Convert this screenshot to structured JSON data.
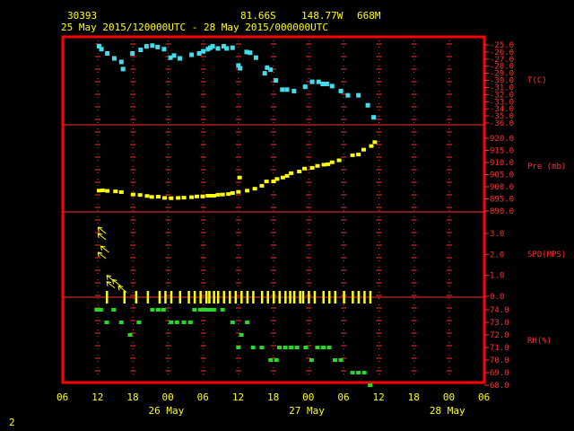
{
  "header": {
    "station": "30393",
    "lat": "81.66S",
    "lon": "148.77W",
    "elev": "668M",
    "time_range": "25 May 2015/120000UTC - 28 May 2015/000000UTC"
  },
  "footer": {
    "page_number": "2"
  },
  "colors": {
    "frame": "#ff0000",
    "grid": "#ff3030",
    "temp": "#44ddee",
    "pressure": "#ffff00",
    "wind": "#ffff00",
    "rh": "#22dd22",
    "label": "#ffff00"
  },
  "chart_data": [
    {
      "type": "scatter",
      "panel": "temperature",
      "ylabel": "T(C)",
      "ylim": [
        -36,
        -24
      ],
      "yticks": [
        "-25.0",
        "-26.0",
        "-27.0",
        "-28.0",
        "-29.0",
        "-30.0",
        "-31.0",
        "-32.0",
        "-33.0",
        "-34.0",
        "-35.0",
        "-36.0"
      ],
      "series": [
        {
          "x": [
            12.2,
            12.6,
            13.6,
            14.8,
            16.0,
            16.3,
            17.9,
            19.3,
            20.3,
            21.3,
            22.2,
            23.3,
            24.4,
            25.0,
            26.0,
            28.0,
            29.3,
            30.0,
            30.8,
            31.2,
            31.6,
            32.5,
            33.5,
            34.0,
            35.0,
            36.0,
            36.3,
            37.4,
            38.0,
            39.0,
            40.5,
            40.9,
            41.5,
            42.4,
            43.5,
            44.3,
            45.5,
            47.4,
            48.6,
            49.7,
            50.4,
            51.1,
            52.0,
            53.5,
            54.7,
            56.5,
            58.1,
            59.1
          ],
          "y": [
            -25.2,
            -25.6,
            -26.2,
            -26.9,
            -27.4,
            -28.4,
            -26.2,
            -25.7,
            -25.2,
            -25.1,
            -25.3,
            -25.6,
            -26.8,
            -26.5,
            -26.9,
            -26.4,
            -26.2,
            -25.9,
            -25.6,
            -25.4,
            -25.2,
            -25.5,
            -25.2,
            -25.5,
            -25.4,
            -27.9,
            -28.3,
            -26.0,
            -26.1,
            -26.8,
            -29.0,
            -28.2,
            -28.5,
            -30.0,
            -31.3,
            -31.3,
            -31.5,
            -30.9,
            -30.2,
            -30.2,
            -30.5,
            -30.5,
            -30.8,
            -31.5,
            -32.1,
            -32.1,
            -33.5,
            -35.2
          ]
        }
      ]
    },
    {
      "type": "scatter",
      "panel": "pressure",
      "ylabel": "Pre (mb)",
      "ylim": [
        890,
        920
      ],
      "yticks": [
        "890.0",
        "895.0",
        "900.0",
        "905.0",
        "910.0",
        "915.0",
        "920.0"
      ],
      "series": [
        {
          "x": [
            12.2,
            12.8,
            13.6,
            15.0,
            16.0,
            18.0,
            19.2,
            20.4,
            21.2,
            22.3,
            23.4,
            24.5,
            25.7,
            26.7,
            28.0,
            28.9,
            29.9,
            30.8,
            31.4,
            31.8,
            32.5,
            33.3,
            34.3,
            35.0,
            36.0,
            36.2,
            37.5,
            38.8,
            40.0,
            40.8,
            42.0,
            42.6,
            43.6,
            44.3,
            45.0,
            46.4,
            47.3,
            48.6,
            49.5,
            50.6,
            51.3,
            52.0,
            53.2,
            55.5,
            56.5,
            57.4,
            58.7,
            59.3
          ],
          "y": [
            898.4,
            898.5,
            898.3,
            898.1,
            897.8,
            896.8,
            896.6,
            896.2,
            895.8,
            895.9,
            895.4,
            895.3,
            895.4,
            895.5,
            895.7,
            896.0,
            896.0,
            896.3,
            896.3,
            896.3,
            896.7,
            896.8,
            897.0,
            897.4,
            897.9,
            903.8,
            898.4,
            899.2,
            900.4,
            902.2,
            902.2,
            903.2,
            903.8,
            904.5,
            905.6,
            906.3,
            907.5,
            907.8,
            908.6,
            909.1,
            909.3,
            910.1,
            910.9,
            913.0,
            913.3,
            915.3,
            916.8,
            918.4
          ]
        }
      ]
    },
    {
      "type": "wind_barbs",
      "panel": "wind",
      "ylabel": "SPD(MPS)",
      "ylim": [
        0,
        4
      ],
      "yticks": [
        "0.0",
        "1.0",
        "2.0",
        "3.0"
      ],
      "series": [
        {
          "x": [
            12.0,
            12.0,
            12.5,
            12.0,
            13.5,
            13.5,
            14.5,
            15.5
          ],
          "speed": [
            3.3,
            3.0,
            2.4,
            2.1,
            1.0,
            0.7,
            0.8,
            0.5
          ]
        },
        {
          "name": "calm",
          "x": [
            13.5,
            16.5,
            18.5,
            20.5,
            22.5,
            23.5,
            24.5,
            26.0,
            27.5,
            28.5,
            29.5,
            30.5,
            31.0,
            31.8,
            32.5,
            33.5,
            34.5,
            35.5,
            36.5,
            37.5,
            38.5,
            40.0,
            41.0,
            42.0,
            43.0,
            44.0,
            44.8,
            45.5,
            46.5,
            47.0,
            48.0,
            49.0,
            50.5,
            51.5,
            52.5,
            54.0,
            55.5,
            56.5,
            57.5,
            58.5
          ],
          "speed": [
            0,
            0,
            0,
            0,
            0,
            0,
            0,
            0,
            0,
            0,
            0,
            0,
            0,
            0,
            0,
            0,
            0,
            0,
            0,
            0,
            0,
            0,
            0,
            0,
            0,
            0,
            0,
            0,
            0,
            0,
            0,
            0,
            0,
            0,
            0,
            0,
            0,
            0,
            0,
            0
          ]
        }
      ]
    },
    {
      "type": "scatter",
      "panel": "rh",
      "ylabel": "RH(%)",
      "ylim": [
        68,
        75
      ],
      "yticks": [
        "68.0",
        "69.0",
        "70.0",
        "71.0",
        "72.0",
        "73.0",
        "74.0"
      ],
      "series": [
        {
          "x": [
            11.8,
            12.5,
            13.5,
            14.7,
            16.0,
            17.5,
            19.0,
            21.3,
            22.3,
            23.2,
            24.5,
            25.5,
            26.7,
            27.8,
            28.5,
            29.5,
            30.2,
            30.8,
            31.2,
            31.8,
            33.3,
            35.0,
            36.0,
            36.5,
            37.5,
            38.5,
            40.0,
            41.5,
            42.5,
            43.0,
            44.0,
            45.0,
            46.0,
            47.5,
            48.5,
            49.5,
            50.5,
            51.5,
            52.5,
            53.5,
            55.5,
            56.5,
            57.5,
            58.5
          ],
          "y": [
            74.0,
            74.0,
            73.0,
            74.0,
            73.0,
            72.0,
            73.0,
            74.0,
            74.0,
            74.0,
            73.0,
            73.0,
            73.0,
            73.0,
            74.0,
            74.0,
            74.0,
            74.0,
            74.0,
            74.0,
            74.0,
            73.0,
            71.0,
            72.0,
            73.0,
            71.0,
            71.0,
            70.0,
            70.0,
            71.0,
            71.0,
            71.0,
            71.0,
            71.0,
            70.0,
            71.0,
            71.0,
            71.0,
            70.0,
            70.0,
            69.0,
            69.0,
            69.0,
            68.0
          ]
        }
      ]
    }
  ],
  "x_axis": {
    "hour_labels": [
      "06",
      "12",
      "18",
      "00",
      "06",
      "12",
      "18",
      "00",
      "06",
      "12",
      "18",
      "00",
      "06"
    ],
    "date_labels": [
      "26 May",
      "27 May",
      "28 May"
    ]
  }
}
